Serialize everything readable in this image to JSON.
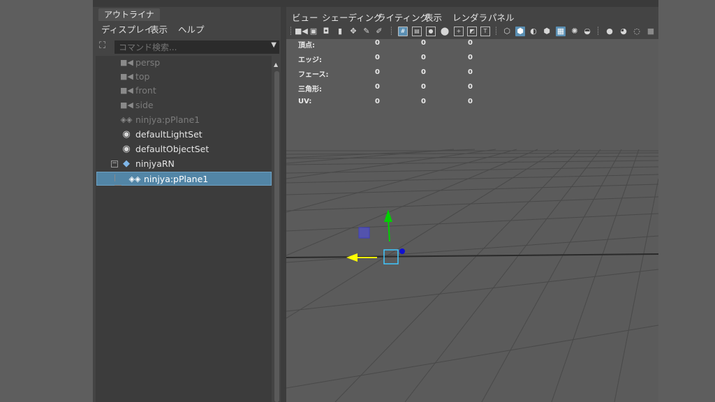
{
  "outliner": {
    "tab_label": "アウトライナ",
    "menu": [
      "ディスプレイ",
      "表示",
      "ヘルプ"
    ],
    "search_placeholder": "コマンド検索...",
    "items": [
      {
        "label": "persp",
        "icon": "camera-icon",
        "state": "dimmed"
      },
      {
        "label": "top",
        "icon": "camera-icon",
        "state": "dimmed"
      },
      {
        "label": "front",
        "icon": "camera-icon",
        "state": "dimmed"
      },
      {
        "label": "side",
        "icon": "camera-icon",
        "state": "dimmed"
      },
      {
        "label": "ninjya:pPlane1",
        "icon": "mesh-plane-icon",
        "state": "dimmed"
      },
      {
        "label": "defaultLightSet",
        "icon": "set-icon",
        "state": "normal"
      },
      {
        "label": "defaultObjectSet",
        "icon": "set-icon",
        "state": "normal"
      },
      {
        "label": "ninjyaRN",
        "icon": "reference-diamond-icon",
        "state": "normal",
        "expander": "⊟"
      },
      {
        "label": "ninjya:pPlane1",
        "icon": "mesh-plane-icon",
        "state": "selected"
      }
    ]
  },
  "viewport": {
    "menu": [
      "ビュー",
      "シェーディング",
      "ライティング",
      "表示",
      "レンダラ",
      "パネル"
    ],
    "toolbar_icons": [
      "select-camera-icon",
      "camera-attributes-icon",
      "bookmark-icon",
      "image-plane-icon",
      "2d-pan-icon",
      "grease-pencil-icon",
      "grid-icon",
      "film-gate-icon",
      "resolution-gate-icon",
      "gate-mask-icon",
      "field-chart-icon",
      "safe-action-icon",
      "safe-title-icon",
      "wireframe-icon",
      "smooth-shade-icon",
      "shade-default-icon",
      "wireframe-on-shaded-icon",
      "textured-icon",
      "use-all-lights-icon",
      "shadows-icon",
      "screen-space-ao-icon",
      "motion-blur-icon",
      "anti-aliasing-icon",
      "depth-of-field-icon",
      "isolate-select-icon"
    ],
    "hud": [
      {
        "label": "頂点:",
        "values": [
          "0",
          "0",
          "0"
        ]
      },
      {
        "label": "エッジ:",
        "values": [
          "0",
          "0",
          "0"
        ]
      },
      {
        "label": "フェース:",
        "values": [
          "0",
          "0",
          "0"
        ]
      },
      {
        "label": "三角形:",
        "values": [
          "0",
          "0",
          "0"
        ]
      },
      {
        "label": "UV:",
        "values": [
          "0",
          "0",
          "0"
        ]
      }
    ],
    "manipulator": {
      "y_axis_color": "#00d000",
      "x_axis_color": "#ffff00",
      "z_axis_color": "#1010d0",
      "center_color": "#40c8ff",
      "plane_handle_color": "#5050d0"
    }
  }
}
